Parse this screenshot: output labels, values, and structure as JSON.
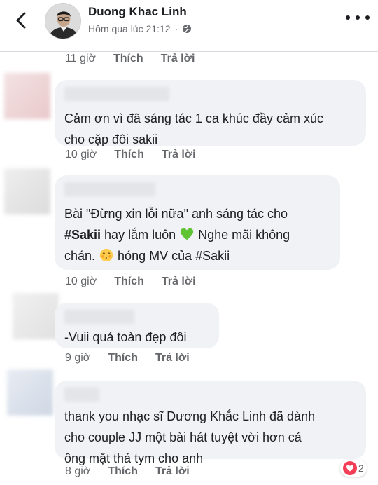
{
  "header": {
    "author_name": "Duong Khac Linh",
    "post_time": "Hôm qua lúc 21:12"
  },
  "top_actions": {
    "time": "11 giờ",
    "like": "Thích",
    "reply": "Trả lời"
  },
  "comments": [
    {
      "text": "Cảm ơn vì đã sáng tác 1 ca khúc đầy cảm xúc\ncho cặp đôi sakii",
      "time": "10 giờ",
      "like": "Thích",
      "reply": "Trả lời"
    },
    {
      "line1": "Bài \"Đừng xin lỗi nữa\" anh sáng tác cho",
      "hashtag1": "#Sakii",
      "line2": " hay lắm luôn ",
      "line2b": " Nghe mãi không",
      "line3a": "chán. ",
      "line3b": " hóng MV của #Sakii",
      "time": "10 giờ",
      "like": "Thích",
      "reply": "Trả lời"
    },
    {
      "text": "-Vuii quá toàn đẹp đôi",
      "time": "9 giờ",
      "like": "Thích",
      "reply": "Trả lời"
    },
    {
      "text": "thank you nhạc sĩ Dương Khắc Linh đã dành\ncho couple JJ một bài hát tuyệt vời hơn cả\nông mặt thả tym cho anh",
      "time": "8 giờ",
      "like": "Thích",
      "reply": "Trả lời",
      "reaction_count": "2"
    }
  ],
  "icons": {
    "back": "chevron-left-icon",
    "more": "more-dots-icon",
    "privacy": "globe-icon",
    "green_heart": "green-heart-emoji",
    "kiss_face": "kissing-face-emoji",
    "reaction": "heart-icon"
  },
  "colors": {
    "bubble": "#f0f2f5",
    "meta_text": "#65676b",
    "green_heart": "#5fc334",
    "reaction_heart": "#f33e58"
  }
}
